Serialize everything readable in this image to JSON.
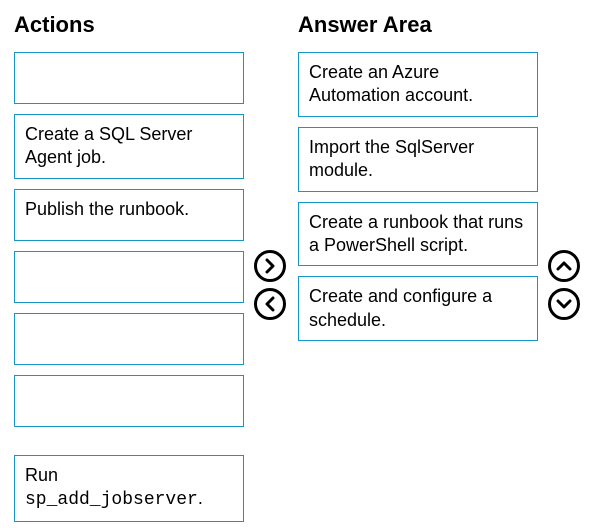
{
  "actions": {
    "heading": "Actions",
    "items": [
      "",
      "Create a SQL Server Agent job.",
      "Publish the runbook.",
      "",
      "",
      "",
      ""
    ],
    "run_prefix": "Run ",
    "run_code": "sp_add_jobserver",
    "run_suffix": "."
  },
  "answer": {
    "heading": "Answer Area",
    "items": [
      "Create an Azure Automation account.",
      "Import the SqlServer module.",
      "Create a runbook that runs a PowerShell script.",
      "Create and configure a schedule."
    ]
  }
}
